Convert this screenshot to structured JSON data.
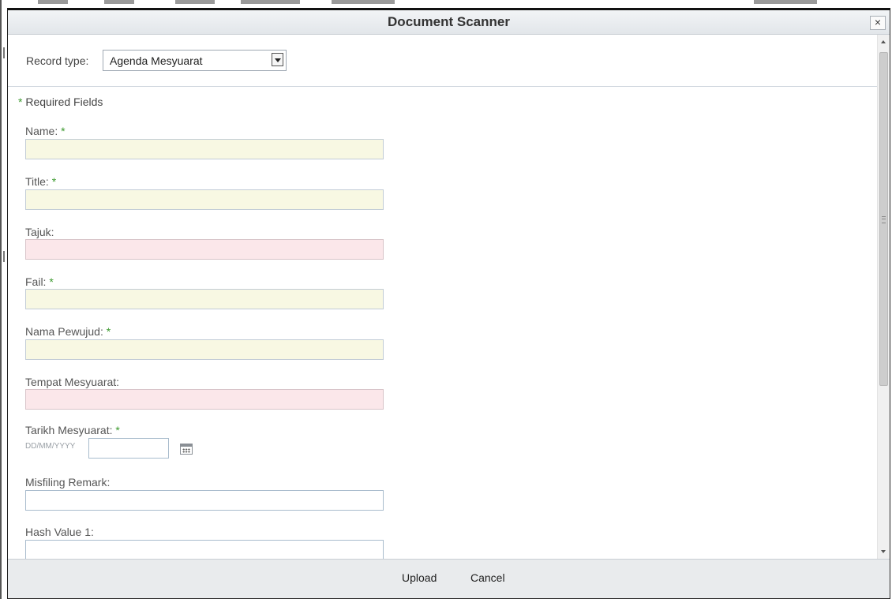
{
  "dialog": {
    "title": "Document Scanner",
    "close_label": "×"
  },
  "record_type": {
    "label": "Record type:",
    "value": "Agenda Mesyuarat"
  },
  "required_note": {
    "star": "*",
    "text": "Required Fields"
  },
  "fields": [
    {
      "label": "Name:",
      "required": "*",
      "style": "yellow"
    },
    {
      "label": "Title:",
      "required": "*",
      "style": "yellow"
    },
    {
      "label": "Tajuk:",
      "required": "",
      "style": "pink"
    },
    {
      "label": "Fail:",
      "required": "*",
      "style": "yellow"
    },
    {
      "label": "Nama Pewujud:",
      "required": "*",
      "style": "yellow"
    },
    {
      "label": "Tempat Mesyuarat:",
      "required": "",
      "style": "pink"
    },
    {
      "label": "Tarikh Mesyuarat:",
      "required": "*",
      "style": "date",
      "placeholder": "DD/MM/YYYY"
    },
    {
      "label": "Misfiling Remark:",
      "required": "",
      "style": "white"
    },
    {
      "label": "Hash Value 1:",
      "required": "",
      "style": "white"
    }
  ],
  "footer": {
    "upload_label": "Upload",
    "cancel_label": "Cancel"
  }
}
